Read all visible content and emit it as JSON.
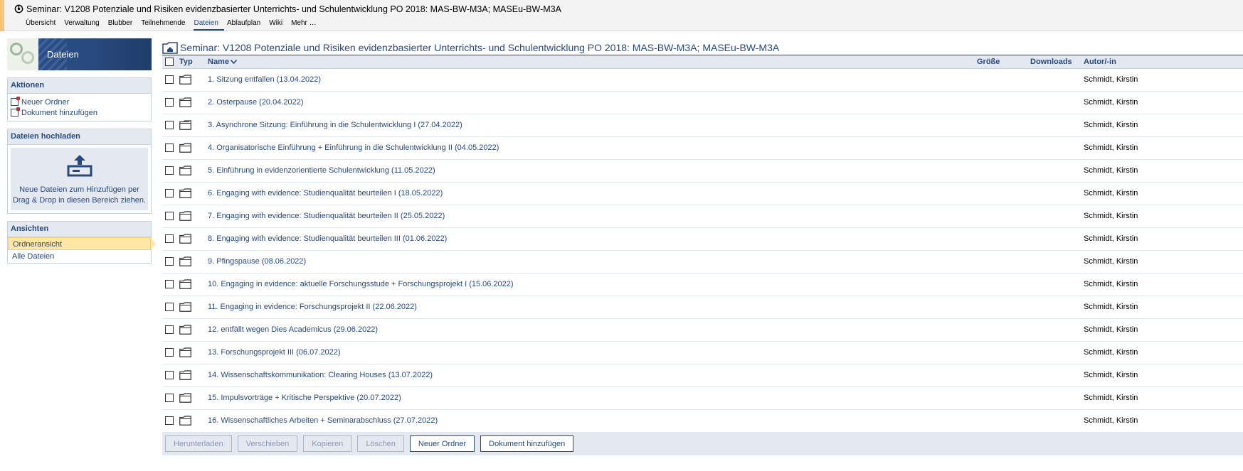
{
  "header": {
    "context_title": "Seminar: V1208 Potenziale und Risiken evidenzbasierter Unterrichts- und Schulentwicklung PO 2018: MAS-BW-M3A; MASEu-BW-M3A",
    "tabs": [
      {
        "label": "Übersicht",
        "active": false
      },
      {
        "label": "Verwaltung",
        "active": false
      },
      {
        "label": "Blubber",
        "active": false
      },
      {
        "label": "Teilnehmende",
        "active": false
      },
      {
        "label": "Dateien",
        "active": true
      },
      {
        "label": "Ablaufplan",
        "active": false
      },
      {
        "label": "Wiki",
        "active": false
      },
      {
        "label": "Mehr …",
        "active": false
      }
    ]
  },
  "sidebar": {
    "title": "Dateien",
    "actions": {
      "title": "Aktionen",
      "items": [
        "Neuer Ordner",
        "Dokument hinzufügen"
      ]
    },
    "upload": {
      "title": "Dateien hochladen",
      "line1": "Neue Dateien zum Hinzufügen per",
      "line2": "Drag & Drop in diesen Bereich ziehen."
    },
    "views": {
      "title": "Ansichten",
      "items": [
        "Ordneransicht",
        "Alle Dateien"
      ],
      "active": "Ordneransicht"
    }
  },
  "main": {
    "heading": "Seminar: V1208 Potenziale und Risiken evidenzbasierter Unterrichts- und Schulentwicklung PO 2018: MAS-BW-M3A; MASEu-BW-M3A",
    "columns": {
      "type": "Typ",
      "name": "Name",
      "size": "Größe",
      "downloads": "Downloads",
      "author": "Autor/-in"
    },
    "rows": [
      {
        "name": "1. Sitzung entfallen (13.04.2022)",
        "author": "Schmidt, Kirstin",
        "icon": "folder-icon"
      },
      {
        "name": "2. Osterpause (20.04.2022)",
        "author": "Schmidt, Kirstin",
        "icon": "folder-icon"
      },
      {
        "name": "3. Asynchrone Sitzung: Einführung in die Schulentwicklung I (27.04.2022)",
        "author": "Schmidt, Kirstin",
        "icon": "folder-full-icon"
      },
      {
        "name": "4. Organisatorische Einführung + Einführung in die Schulentwicklung II (04.05.2022)",
        "author": "Schmidt, Kirstin",
        "icon": "folder-icon"
      },
      {
        "name": "5. Einführung in evidenzorientierte Schulentwicklung (11.05.2022)",
        "author": "Schmidt, Kirstin",
        "icon": "folder-icon"
      },
      {
        "name": "6. Engaging with evidence: Studienqualität beurteilen I (18.05.2022)",
        "author": "Schmidt, Kirstin",
        "icon": "folder-icon"
      },
      {
        "name": "7. Engaging with evidence: Studienqualität beurteilen II (25.05.2022)",
        "author": "Schmidt, Kirstin",
        "icon": "folder-icon"
      },
      {
        "name": "8. Engaging with evidence: Studienqualität beurteilen III (01.06.2022)",
        "author": "Schmidt, Kirstin",
        "icon": "folder-icon"
      },
      {
        "name": "9. Pfingspause (08.06.2022)",
        "author": "Schmidt, Kirstin",
        "icon": "folder-icon"
      },
      {
        "name": "10. Engaging in evidence: aktuelle Forschungsstude + Forschungsprojekt I (15.06.2022)",
        "author": "Schmidt, Kirstin",
        "icon": "folder-icon"
      },
      {
        "name": "11. Engaging in evidence: Forschungsprojekt II (22.06.2022)",
        "author": "Schmidt, Kirstin",
        "icon": "folder-icon"
      },
      {
        "name": "12. entfällt wegen Dies Academicus (29.06.2022)",
        "author": "Schmidt, Kirstin",
        "icon": "folder-icon"
      },
      {
        "name": "13. Forschungsprojekt III (06.07.2022)",
        "author": "Schmidt, Kirstin",
        "icon": "folder-icon"
      },
      {
        "name": "14. Wissenschaftskommunikation: Clearing Houses (13.07.2022)",
        "author": "Schmidt, Kirstin",
        "icon": "folder-icon"
      },
      {
        "name": "15. Impulsvorträge + Kritische Perspektive (20.07.2022)",
        "author": "Schmidt, Kirstin",
        "icon": "folder-icon"
      },
      {
        "name": "16. Wissenschaftliches Arbeiten + Seminarabschluss (27.07.2022)",
        "author": "Schmidt, Kirstin",
        "icon": "folder-icon"
      }
    ],
    "buttons": [
      {
        "label": "Herunterladen",
        "enabled": false
      },
      {
        "label": "Verschieben",
        "enabled": false
      },
      {
        "label": "Kopieren",
        "enabled": false
      },
      {
        "label": "Löschen",
        "enabled": false
      },
      {
        "label": "Neuer Ordner",
        "enabled": true
      },
      {
        "label": "Dokument hinzufügen",
        "enabled": true
      }
    ]
  },
  "colors": {
    "primary": "#28497c",
    "header_bg": "#f3f3f3",
    "table_header_bg": "#e4e9f1",
    "active_view": "#ffe7a8",
    "accent": "#f7c27a"
  }
}
